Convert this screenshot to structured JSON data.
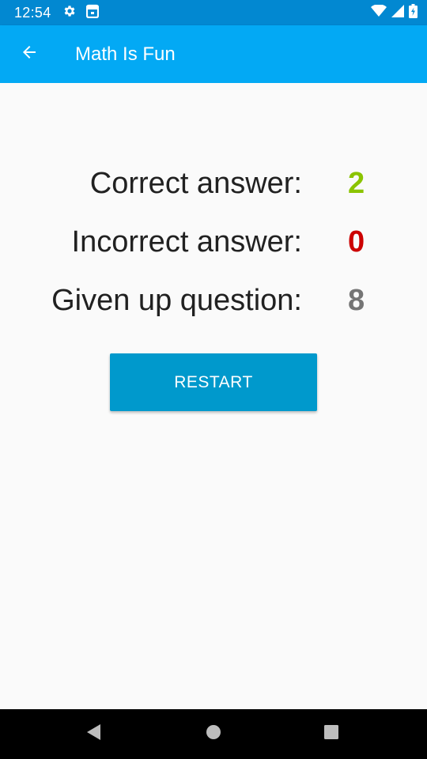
{
  "status_bar": {
    "time": "12:54",
    "icons_left": [
      "gear-icon",
      "clipboard-icon"
    ],
    "icons_right": [
      "wifi-icon",
      "signal-icon",
      "battery-icon"
    ]
  },
  "app_bar": {
    "title": "Math Is Fun",
    "back_icon": "arrow-back-icon",
    "color": "#03a9f4"
  },
  "results": {
    "correct": {
      "label": "Correct answer:",
      "value": "2",
      "color": "#8bc400"
    },
    "incorrect": {
      "label": "Incorrect answer:",
      "value": "0",
      "color": "#cc0000"
    },
    "given_up": {
      "label": "Given up question:",
      "value": "8",
      "color": "#757575"
    }
  },
  "restart_button": {
    "label": "RESTART",
    "color": "#0099cc"
  },
  "nav_bar": {
    "icons": [
      "back-triangle-icon",
      "home-circle-icon",
      "recents-square-icon"
    ]
  }
}
